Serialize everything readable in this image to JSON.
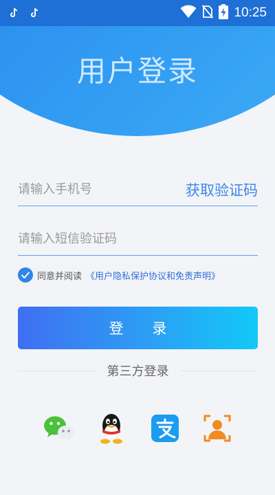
{
  "status_bar": {
    "time": "10:25",
    "left_icons": [
      "tiktok-icon",
      "tiktok-icon"
    ],
    "right_icons": [
      "wifi-icon",
      "no-sim-icon",
      "battery-charging-icon"
    ]
  },
  "header": {
    "title": "用户登录"
  },
  "form": {
    "phone_placeholder": "请输入手机号",
    "get_code_label": "获取验证码",
    "code_placeholder": "请输入短信验证码"
  },
  "agreement": {
    "checked": true,
    "text": "同意并阅读",
    "link": "《用户隐私保护协议和免责声明》"
  },
  "login_button": {
    "label": "登 录"
  },
  "third_party": {
    "divider_label": "第三方登录",
    "providers": [
      "wechat-icon",
      "qq-icon",
      "alipay-icon",
      "face-login-icon"
    ]
  },
  "colors": {
    "accent": "#2f86e8",
    "link": "#2f6fd8",
    "background": "#f3f4f8"
  }
}
